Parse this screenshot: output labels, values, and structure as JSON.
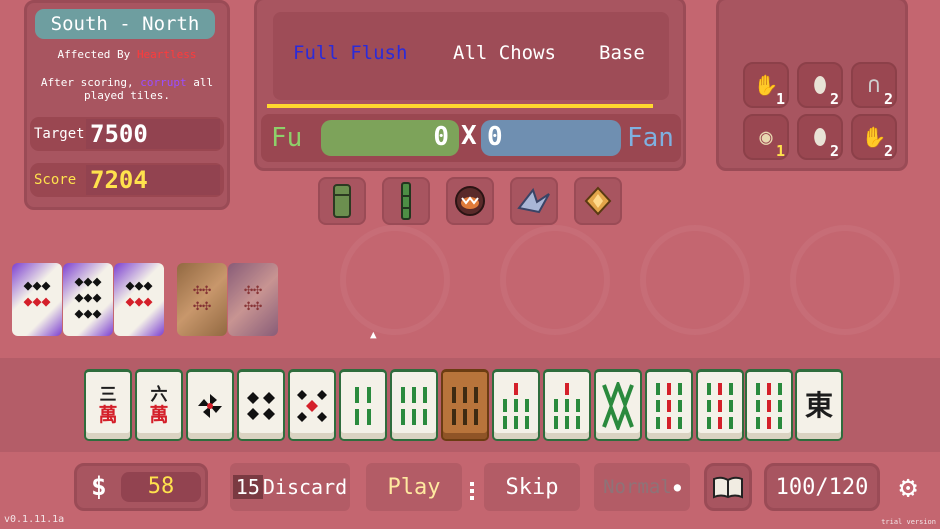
{
  "boss": {
    "title": "South - North",
    "affected_prefix": "Affected By",
    "affected_name": "Heartless",
    "effect_prefix": "After scoring,",
    "effect_keyword": "corrupt",
    "effect_suffix": "all played tiles."
  },
  "stats": {
    "target_label": "Target",
    "target_value": "7500",
    "score_label": "Score",
    "score_value": "7204"
  },
  "yaku": [
    "Full Flush",
    "All Chows",
    "Base"
  ],
  "scoring": {
    "fu_label": "Fu",
    "fu_value": "0",
    "times": "X",
    "fan_value": "0",
    "fan_label": "Fan"
  },
  "tools": [
    {
      "icon": "bamboo-tube-icon"
    },
    {
      "icon": "bamboo-stick-icon"
    },
    {
      "icon": "monster-mouth-icon"
    },
    {
      "icon": "origami-crane-icon"
    },
    {
      "icon": "diamond-star-icon"
    }
  ],
  "charms": [
    {
      "icon": "fan-cards-icon",
      "count": "1"
    },
    {
      "icon": "egg-icon",
      "count": "2"
    },
    {
      "icon": "horseshoe-icon",
      "count": "2"
    },
    {
      "icon": "eye-icon",
      "count": "1"
    },
    {
      "icon": "egg-icon",
      "count": "2"
    },
    {
      "icon": "fan-cards-icon",
      "count": "2"
    }
  ],
  "hand": [
    {
      "top": "三",
      "bottom": "萬",
      "kind": "char"
    },
    {
      "top": "六",
      "bottom": "萬",
      "kind": "char"
    },
    {
      "glyph": "✣",
      "kind": "dot"
    },
    {
      "glyph": "◆◆\n◆◆",
      "kind": "dot"
    },
    {
      "glyph": "◆ ◆\n ✣ \n◆ ◆",
      "kind": "dot"
    },
    {
      "glyph": "║ ║\n║ ║",
      "kind": "bam"
    },
    {
      "glyph": "║║║\n║║║",
      "kind": "bam"
    },
    {
      "glyph": "║║║\n║║║",
      "kind": "bam",
      "selected": true
    },
    {
      "glyph": " ║ \n║║║\n║║║",
      "kind": "bam"
    },
    {
      "glyph": " ║ \n║║║\n║║║",
      "kind": "bam"
    },
    {
      "glyph": "W\nM",
      "kind": "bam"
    },
    {
      "glyph": "║║║\n║║║\n║║║",
      "kind": "bam"
    },
    {
      "glyph": "║║║\n║║║\n║║║",
      "kind": "bam"
    },
    {
      "glyph": "║║║\n║║║\n║║║",
      "kind": "bam"
    },
    {
      "top": "東",
      "kind": "wind"
    }
  ],
  "bottom": {
    "money_symbol": "$",
    "money_value": "58",
    "discard_count": "15",
    "discard_label": "Discard",
    "play_label": "Play",
    "skip_label": "Skip",
    "speed_label": "Normal",
    "deck_count": "100/120",
    "version": "v0.1.11.1a",
    "trial": "trial version"
  },
  "colors": {
    "background": "#c46670",
    "yaku_highlight": "#2b2bd9",
    "target_value": "#ffffff",
    "score_value": "#ffe24d",
    "fu_bar": "#7da35a",
    "fan_bar": "#6f8fb1",
    "progress": "#ffd92e"
  }
}
